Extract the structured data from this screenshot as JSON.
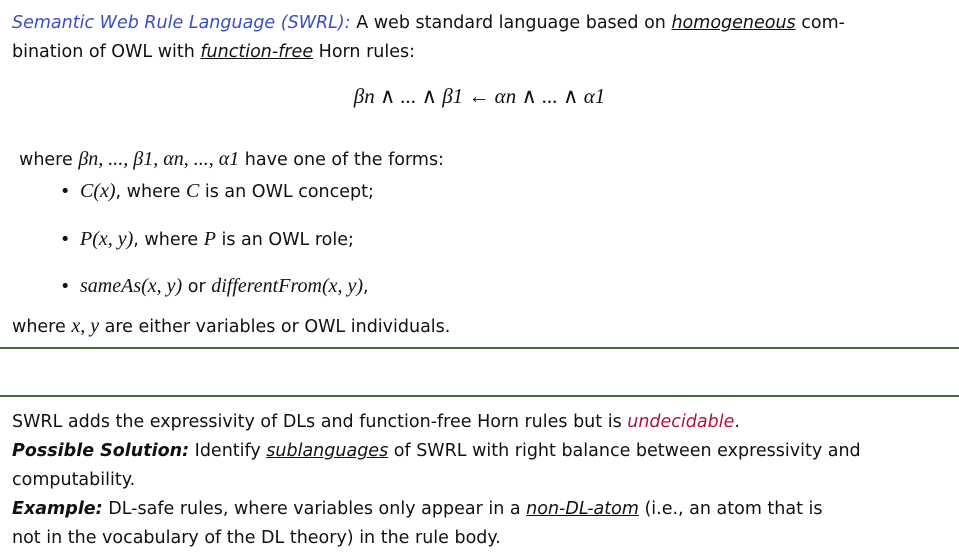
{
  "intro": {
    "term": "Semantic Web Rule Language (SWRL):",
    "text1": " A web standard language based on ",
    "homogeneous": "homogeneous",
    "text2": " com-",
    "text3": "bination of OWL with ",
    "function_free": "function-free",
    "text4": " Horn rules:"
  },
  "formula": "βn ∧ ... ∧ β1 ← αn ∧ ... ∧ α1",
  "where": {
    "prefix": "where ",
    "vars": "βn, ..., β1, αn, ..., α1",
    "suffix": " have one of the forms:"
  },
  "forms": [
    {
      "math": "C(x)",
      "text": ", where ",
      "math2": "C",
      "text2": " is an OWL concept;"
    },
    {
      "math": "P(x, y)",
      "text": ", where ",
      "math2": "P",
      "text2": " is an OWL role;"
    },
    {
      "math": "sameAs(x, y)",
      "text": " or ",
      "math2": "differentFrom(x, y)",
      "text2": ","
    }
  ],
  "closing": {
    "prefix": "where ",
    "vars": "x, y",
    "suffix": " are either variables or OWL individuals."
  },
  "bottom": {
    "line1a": "SWRL adds the expressivity of DLs and function-free Horn rules but is ",
    "undecidable": "undecidable",
    "line1b": ".",
    "solution_label": "Possible Solution:",
    "solution_a": " Identify ",
    "sublanguages": "sublanguages",
    "solution_b": " of SWRL with right balance between expressivity and",
    "solution_c": "computability.",
    "example_label": "Example:",
    "example_a": " DL-safe rules, where variables only appear in a ",
    "non_dl_atom": "non-DL-atom",
    "example_b": " (i.e., an atom that is",
    "example_c": "not in the vocabulary of the DL theory) in the rule body."
  },
  "colors": {
    "accent_blue": "#3a4fc4",
    "accent_red": "#b2123a",
    "separator": "#4c6b32"
  }
}
